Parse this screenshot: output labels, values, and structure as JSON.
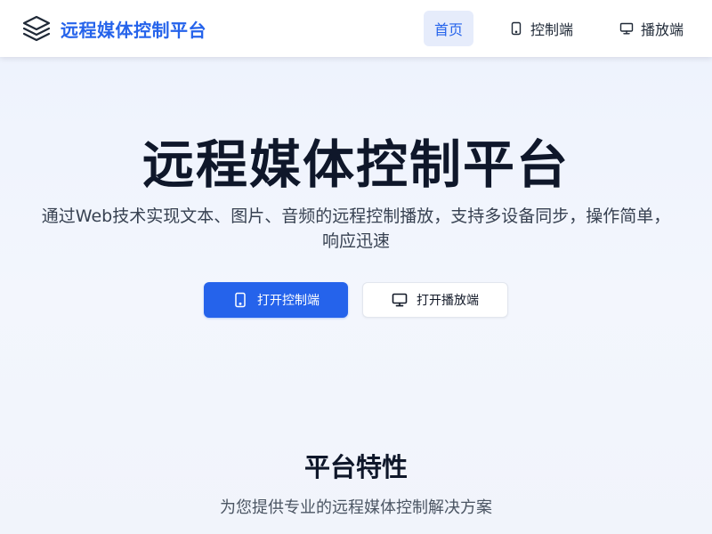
{
  "brand": {
    "title": "远程媒体控制平台",
    "icon": "layers-icon",
    "color": "#2563eb"
  },
  "nav": {
    "items": [
      {
        "label": "首页",
        "active": true
      },
      {
        "label": "控制端",
        "icon": "smartphone-icon"
      },
      {
        "label": "播放端",
        "icon": "monitor-icon"
      }
    ]
  },
  "hero": {
    "title": "远程媒体控制平台",
    "subtitle_line1": "通过Web技术实现文本、图片、音频的远程控制播放，支持多设备同步，操作简单，",
    "subtitle_line2": "响应迅速",
    "primary_button": {
      "label": "打开控制端",
      "icon": "smartphone-icon"
    },
    "secondary_button": {
      "label": "打开播放端",
      "icon": "monitor-icon"
    }
  },
  "features": {
    "title": "平台特性",
    "subtitle": "为您提供专业的远程媒体控制解决方案"
  }
}
